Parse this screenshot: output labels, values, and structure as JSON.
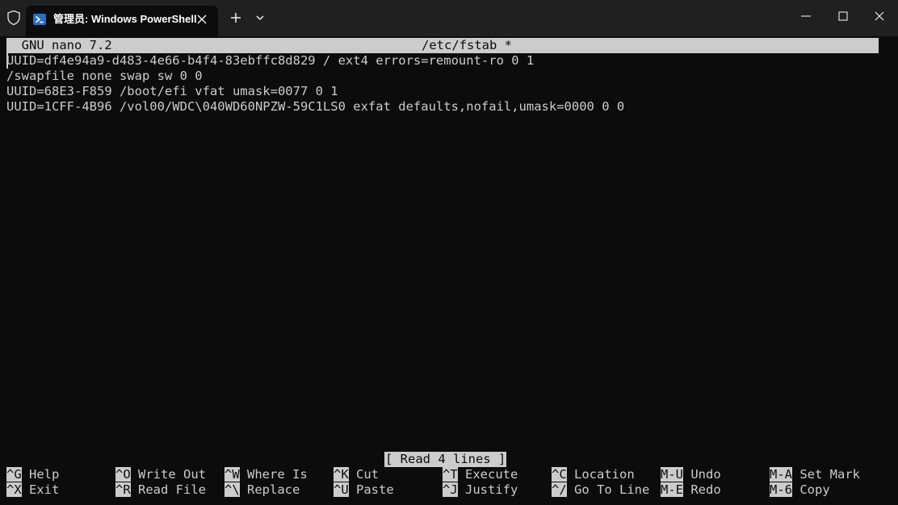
{
  "window": {
    "tab_title": "管理员: Windows PowerShell",
    "icons": {
      "shield": "shield-icon",
      "powershell": "powershell-icon",
      "close_tab": "close-icon",
      "new_tab": "plus-icon",
      "dropdown": "chevron-down-icon",
      "minimize": "minimize-icon",
      "maximize": "maximize-icon",
      "close_window": "close-icon"
    }
  },
  "nano": {
    "header_left": "  GNU nano 7.2",
    "header_center": "/etc/fstab *",
    "lines": [
      "UUID=df4e94a9-d483-4e66-b4f4-83ebffc8d829 / ext4 errors=remount-ro 0 1",
      "/swapfile none swap sw 0 0",
      "UUID=68E3-F859 /boot/efi vfat umask=0077 0 1",
      "UUID=1CFF-4B96 /vol00/WDC\\040WD60NPZW-59C1LS0 exfat defaults,nofail,umask=0000 0 0"
    ],
    "status_message": "[ Read 4 lines ]",
    "shortcuts_row1": [
      {
        "key": "^G",
        "label": "Help"
      },
      {
        "key": "^O",
        "label": "Write Out"
      },
      {
        "key": "^W",
        "label": "Where Is"
      },
      {
        "key": "^K",
        "label": "Cut"
      },
      {
        "key": "^T",
        "label": "Execute"
      },
      {
        "key": "^C",
        "label": "Location"
      },
      {
        "key": "M-U",
        "label": "Undo"
      },
      {
        "key": "M-A",
        "label": "Set Mark"
      }
    ],
    "shortcuts_row2": [
      {
        "key": "^X",
        "label": "Exit"
      },
      {
        "key": "^R",
        "label": "Read File"
      },
      {
        "key": "^\\",
        "label": "Replace"
      },
      {
        "key": "^U",
        "label": "Paste"
      },
      {
        "key": "^J",
        "label": "Justify"
      },
      {
        "key": "^/",
        "label": "Go To Line"
      },
      {
        "key": "M-E",
        "label": "Redo"
      },
      {
        "key": "M-6",
        "label": "Copy"
      }
    ]
  },
  "colors": {
    "titlebar_bg": "#202020",
    "terminal_bg": "#0c0c0c",
    "terminal_fg": "#cccccc",
    "powershell_blue": "#2f6cc4"
  }
}
